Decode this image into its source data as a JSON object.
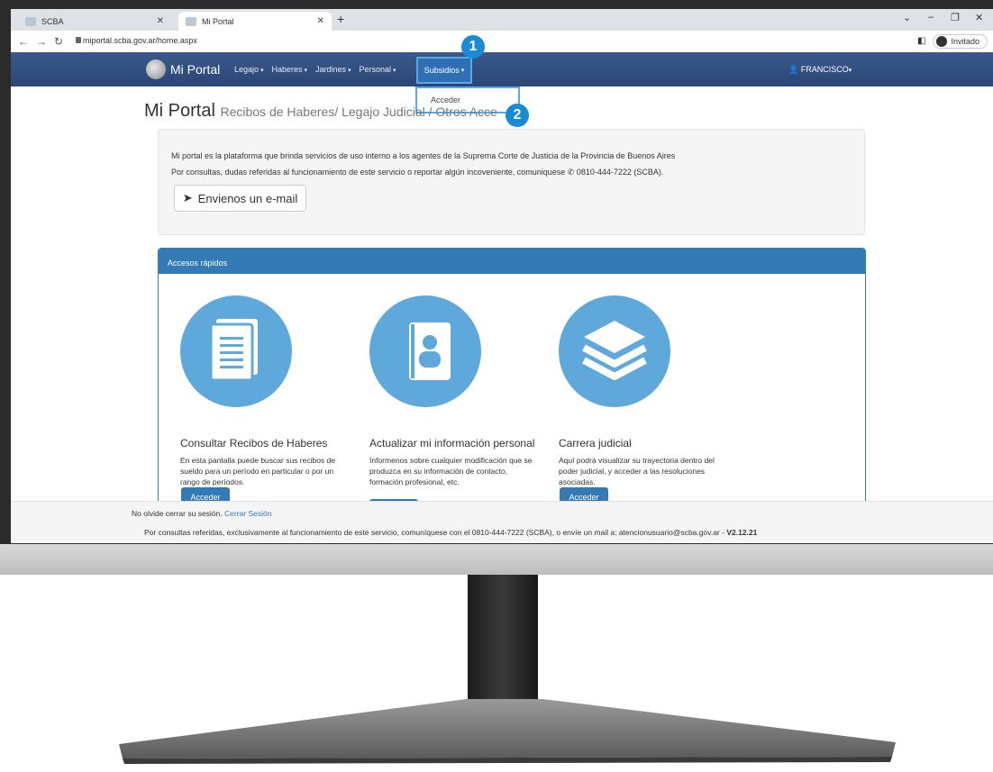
{
  "browser": {
    "tabs": [
      {
        "label": "SCBA"
      },
      {
        "label": "Mi Portal"
      }
    ],
    "url": "miportal.scba.gov.ar/home.aspx",
    "profile_label": "Invitado"
  },
  "navbar": {
    "brand": "Mi Portal",
    "menu": [
      "Legajo",
      "Haberes",
      "Jardines",
      "Personal"
    ],
    "active_menu": "Subsidios",
    "dropdown_item": "Acceder",
    "user": "FRANCISCO"
  },
  "annotations": {
    "step1": "1",
    "step2": "2"
  },
  "header": {
    "title": "Mi Portal",
    "subtitle": "Recibos de Haberes/ Legajo Judicial / Otros Acce"
  },
  "info": {
    "line1": "Mi portal es la plataforma que brinda servicios de uso interno a los agentes de la Suprema Corte de Justicia de la Provincia de Buenos Aires",
    "line2": "Por consultas, dudas referidas al funcionamiento de este servicio o reportar algún incoveniente, comuniquese",
    "phone": "0810-444-7222 (SCBA).",
    "email_button": "Envienos un e-mail"
  },
  "panel": {
    "title": "Accesos rápidos",
    "cards": [
      {
        "title": "Consultar Recibos de Haberes",
        "text": "En esta pantalla puede buscar sus recibos de sueldo para un período en particular o por un rango de períodos.",
        "button": "Acceder"
      },
      {
        "title": "Actualizar mi información personal",
        "text": "Informenos sobre cualquier modificación que se produzca en su información de contacto, formación profesional, etc.",
        "button": ""
      },
      {
        "title": "Carrera judicial",
        "text": "Aquí podrá visualizar su trayectoria dentro del poder judicial, y acceder a las resoluciones asociadas.",
        "button": "Acceder"
      }
    ]
  },
  "footer": {
    "session_text": "No olvide cerrar su sesión.",
    "logout_link": "Cerrar Sesión",
    "contact": "Por consultas referidas, exclusivamente al funcionamiento de este servicio, comuníquese con el 0810-444-7222 (SCBA), o envíe un mail a: atencionusuario@scba.gov.ar -",
    "version": "V2.12.21"
  }
}
